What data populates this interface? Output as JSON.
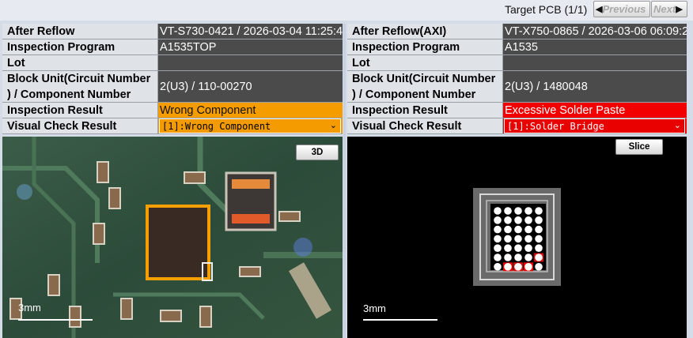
{
  "topbar": {
    "target_label": "Target PCB (1/1)",
    "previous_label": "Previous",
    "next_label": "Next"
  },
  "left_panel": {
    "rows": [
      {
        "label": "After Reflow",
        "value": "VT-S730-0421 / 2026-03-04 11:25:4"
      },
      {
        "label": "Inspection Program",
        "value": "A1535TOP"
      },
      {
        "label": "Lot",
        "value": ""
      },
      {
        "label": "Block Unit(Circuit Number ) / Component Number",
        "value": "2(U3) / 110-00270"
      },
      {
        "label": "Inspection Result",
        "value": "Wrong Component"
      },
      {
        "label": "Visual Check Result",
        "value": "[1]:Wrong Component"
      }
    ],
    "image_button": "3D",
    "scale_label": "3mm",
    "result_color": "#f59c00"
  },
  "right_panel": {
    "rows": [
      {
        "label": "After Reflow(AXI)",
        "value": "VT-X750-0865 / 2026-03-06 06:09:2"
      },
      {
        "label": "Inspection Program",
        "value": "A1535"
      },
      {
        "label": "Lot",
        "value": ""
      },
      {
        "label": "Block Unit(Circuit Number ) / Component Number",
        "value": "2(U3) / 1480048"
      },
      {
        "label": "Inspection Result",
        "value": "Excessive Solder Paste"
      },
      {
        "label": "Visual Check Result",
        "value": "[1]:Solder Bridge"
      }
    ],
    "image_button": "Slice",
    "scale_label": "3mm",
    "result_color": "#f20000"
  }
}
